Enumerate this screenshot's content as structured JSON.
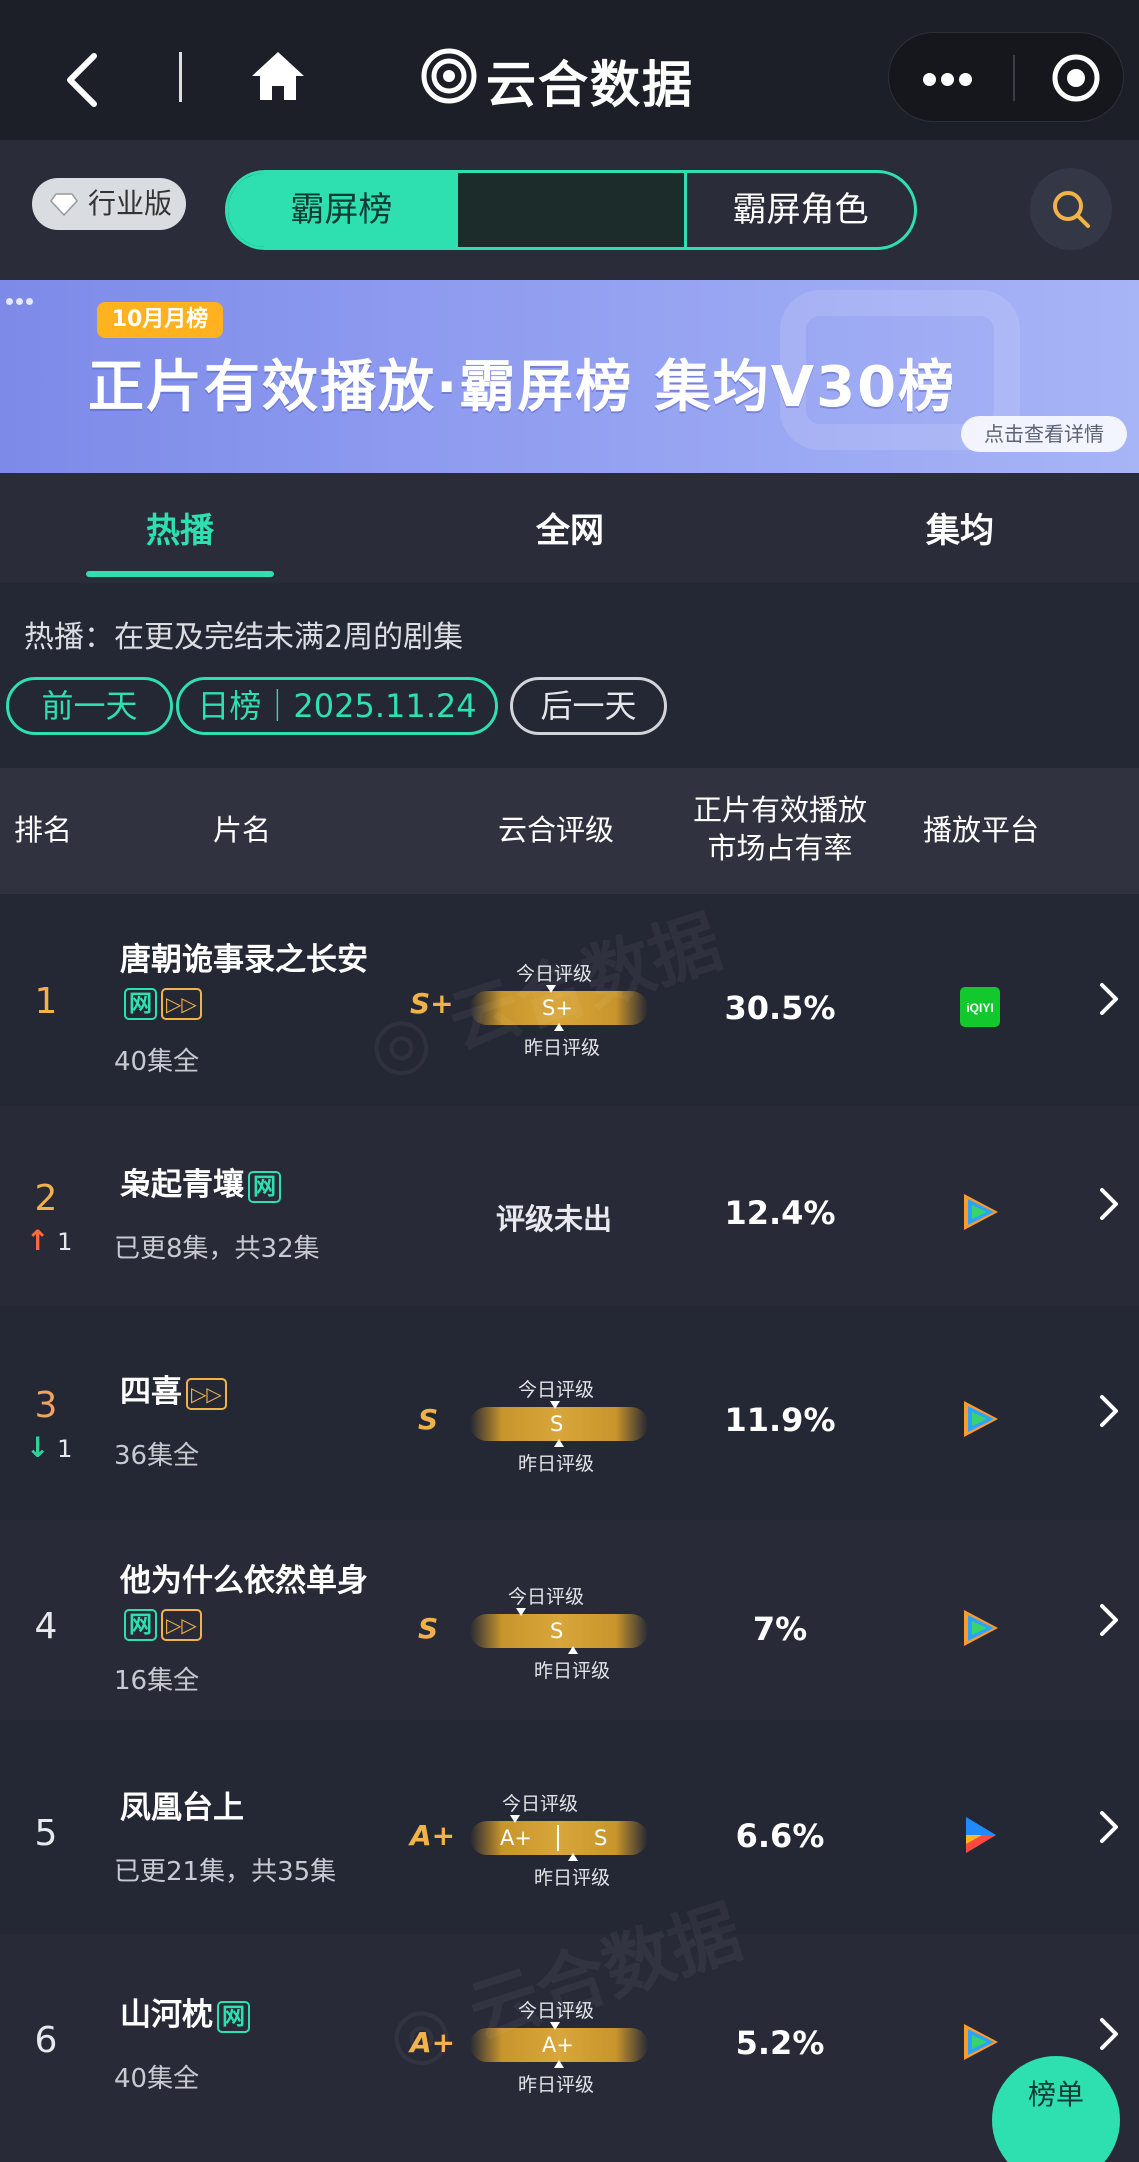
{
  "app": {
    "title": "云合数据"
  },
  "toolbar": {
    "edition_label": "行业版"
  },
  "segments": [
    {
      "label": "霸屏榜"
    },
    {
      "label": ""
    },
    {
      "label": "霸屏角色"
    }
  ],
  "banner": {
    "badge": "10月月榜",
    "headline": "正片有效播放·霸屏榜 集均V30榜",
    "detail_link": "点击查看详情"
  },
  "subtabs": [
    {
      "label": "热播"
    },
    {
      "label": "全网"
    },
    {
      "label": "集均"
    }
  ],
  "description": "热播：在更及完结未满2周的剧集",
  "date_nav": {
    "prev": "前一天",
    "current": "日榜｜2025.11.24",
    "next": "后一天"
  },
  "table_header": {
    "rank": "排名",
    "title": "片名",
    "grade": "云合评级",
    "share_line1": "正片有效播放",
    "share_line2": "市场占有率",
    "platform": "播放平台"
  },
  "grade_labels": {
    "today": "今日评级",
    "yesterday": "昨日评级"
  },
  "rows": [
    {
      "rank": "1",
      "title": "唐朝诡事录之长安",
      "tags": [
        "网",
        "vip"
      ],
      "episodes": "40集全",
      "grade": "S+",
      "today_grade": "S+",
      "yesterday_grade": "",
      "share": "30.5%",
      "platform": "iqiyi",
      "platform_text": "iQIYI"
    },
    {
      "rank": "2",
      "delta": "1",
      "delta_dir": "up",
      "title": "枭起青壤",
      "tags": [
        "网"
      ],
      "episodes": "已更8集，共32集",
      "grade": "",
      "grade_note": "评级未出",
      "share": "12.4%",
      "platform": "tencent-video"
    },
    {
      "rank": "3",
      "delta": "1",
      "delta_dir": "down",
      "title": "四喜",
      "tags": [
        "vip"
      ],
      "episodes": "36集全",
      "grade": "S",
      "today_grade": "S",
      "share": "11.9%",
      "platform": "tencent-video"
    },
    {
      "rank": "4",
      "title": "他为什么依然单身",
      "tags": [
        "网",
        "vip"
      ],
      "episodes": "16集全",
      "grade": "S",
      "today_grade": "S",
      "share": "7%",
      "platform": "tencent-video"
    },
    {
      "rank": "5",
      "title": "凤凰台上",
      "tags": [],
      "episodes": "已更21集，共35集",
      "grade": "A+",
      "today_grade": "A+",
      "yesterday_grade": "S",
      "share": "6.6%",
      "platform": "youku"
    },
    {
      "rank": "6",
      "title": "山河枕",
      "tags": [
        "网"
      ],
      "episodes": "40集全",
      "grade": "A+",
      "today_grade": "A+",
      "share": "5.2%",
      "platform": "tencent-video"
    }
  ],
  "float_button": {
    "label": "榜单"
  },
  "colors": {
    "accent": "#2ee0b0",
    "gold": "#f1b24a",
    "bg": "#242734",
    "up": "#ff6a3d",
    "down": "#33d19a"
  }
}
